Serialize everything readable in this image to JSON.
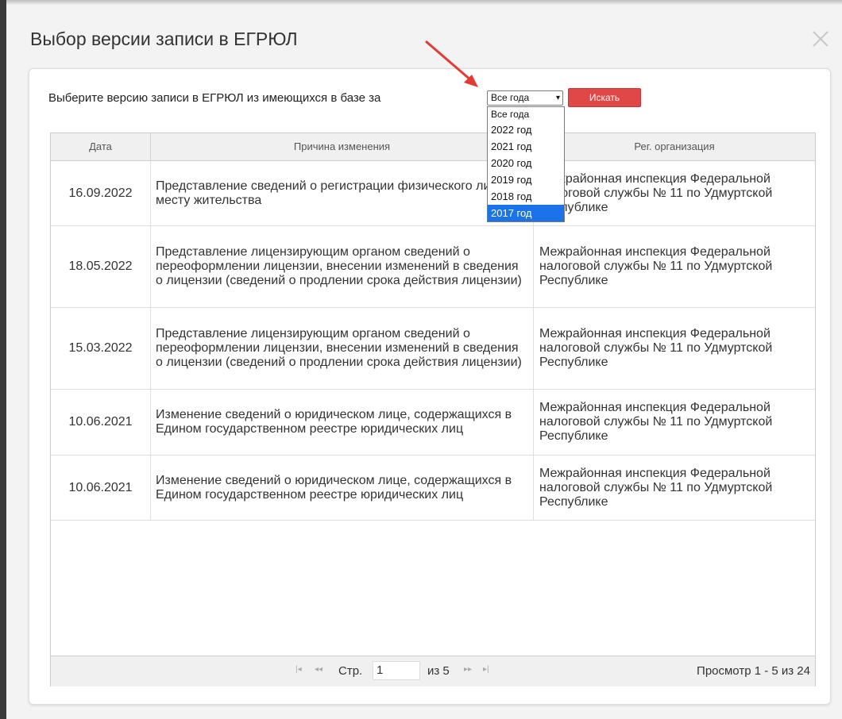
{
  "dialog": {
    "title": "Выбор версии записи в ЕГРЮЛ",
    "prompt": "Выберите версию записи в ЕГРЮЛ из имеющихся в базе за",
    "year_select_value": "Все года",
    "search_label": "Искать",
    "dropdown_options": [
      "Все года",
      "2022 год",
      "2021 год",
      "2020 год",
      "2019 год",
      "2018 год",
      "2017 год"
    ],
    "dropdown_highlighted": "2017 год"
  },
  "table": {
    "headers": {
      "date": "Дата",
      "reason": "Причина изменения",
      "org": "Рег. организация"
    },
    "rows": [
      {
        "date": "16.09.2022",
        "reason": "Представление сведений о регистрации физического лица по месту жительства",
        "org": "Межрайонная инспекция Федеральной налоговой службы № 11 по Удмуртской Республике"
      },
      {
        "date": "18.05.2022",
        "reason": "Представление лицензирующим органом сведений о переоформлении лицензии, внесении изменений в сведения о лицензии (сведений о продлении срока действия лицензии)",
        "org": "Межрайонная инспекция Федеральной налоговой службы № 11 по Удмуртской Республике"
      },
      {
        "date": "15.03.2022",
        "reason": "Представление лицензирующим органом сведений о переоформлении лицензии, внесении изменений в сведения о лицензии (сведений о продлении срока действия лицензии)",
        "org": "Межрайонная инспекция Федеральной налоговой службы № 11 по Удмуртской Республике"
      },
      {
        "date": "10.06.2021",
        "reason": "Изменение сведений о юридическом лице, содержащихся в Едином государственном реестре юридических лиц",
        "org": "Межрайонная инспекция Федеральной налоговой службы № 11 по Удмуртской Республике"
      },
      {
        "date": "10.06.2021",
        "reason": "Изменение сведений о юридическом лице, содержащихся в Едином государственном реестре юридических лиц",
        "org": "Межрайонная инспекция Федеральной налоговой службы № 11 по Удмуртской Республике"
      }
    ]
  },
  "pager": {
    "page_label": "Стр.",
    "page_value": "1",
    "of_label": "из 5",
    "total_label": "Просмотр 1 - 5 из 24"
  },
  "icons": [
    "close-icon",
    "chevron-down-icon",
    "first-page-icon",
    "prev-page-icon",
    "next-page-icon",
    "last-page-icon",
    "annotation-arrow-icon"
  ],
  "colors": {
    "search_button": "#e04848",
    "selected_option": "#1a73e8",
    "annotation_arrow": "#e53935"
  }
}
